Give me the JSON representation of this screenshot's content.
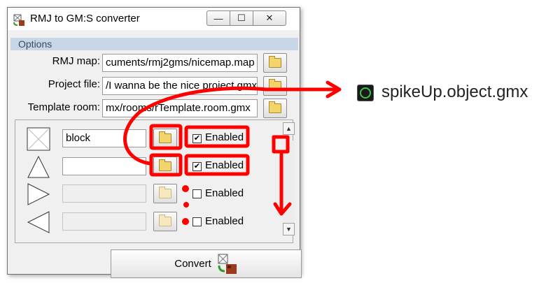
{
  "window": {
    "title": "RMJ to GM:S converter",
    "minimize_glyph": "—",
    "maximize_glyph": "☐",
    "close_glyph": "✕"
  },
  "options": {
    "section_label": "Options",
    "rmj_map": {
      "label": "RMJ map:",
      "value": "cuments/rmj2gms/nicemap.map"
    },
    "project_file": {
      "label": "Project file:",
      "value": "/I wanna be the nice project.gmx"
    },
    "template_room": {
      "label": "Template room:",
      "value": "mx/rooms/rTemplate.room.gmx"
    }
  },
  "mappings": [
    {
      "icon": "block-icon",
      "name": "block",
      "enabled": true,
      "enabled_label": "Enabled",
      "field_enabled": true
    },
    {
      "icon": "spike-up-icon",
      "name": "",
      "enabled": true,
      "enabled_label": "Enabled",
      "field_enabled": true
    },
    {
      "icon": "spike-right-icon",
      "name": "",
      "enabled": false,
      "enabled_label": "Enabled",
      "field_enabled": false
    },
    {
      "icon": "spike-left-icon",
      "name": "",
      "enabled": false,
      "enabled_label": "Enabled",
      "field_enabled": false
    }
  ],
  "convert": {
    "label": "Convert"
  },
  "annotation": {
    "file_name": "spikeUp.object.gmx",
    "file_icon": "gamemaker-object-icon"
  },
  "colors": {
    "annotation_red": "#ff0000",
    "options_header_bg": "#c8d6e8"
  }
}
